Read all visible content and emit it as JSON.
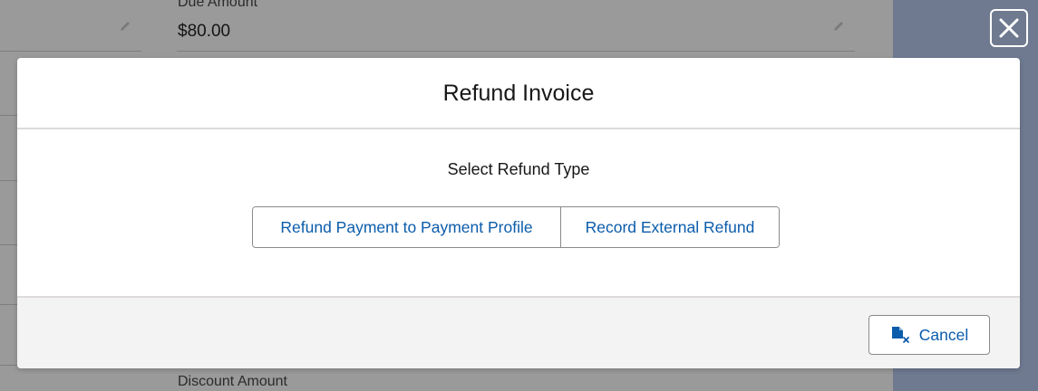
{
  "background": {
    "due_amount_label": "Due Amount",
    "due_amount_value": "$80.00",
    "discount_amount_label": "Discount Amount"
  },
  "modal": {
    "title": "Refund Invoice",
    "refund_type_label": "Select Refund Type",
    "options": [
      {
        "label": "Refund Payment to Payment Profile"
      },
      {
        "label": "Record External Refund"
      }
    ],
    "cancel_label": "Cancel"
  },
  "icons": {
    "close": "close-icon",
    "cancel": "document-cancel-icon",
    "edit": "pencil-icon"
  },
  "colors": {
    "link_blue": "#0b5cab",
    "overlay": "#9a9a9a",
    "footer_bg": "#f3f3f3"
  }
}
